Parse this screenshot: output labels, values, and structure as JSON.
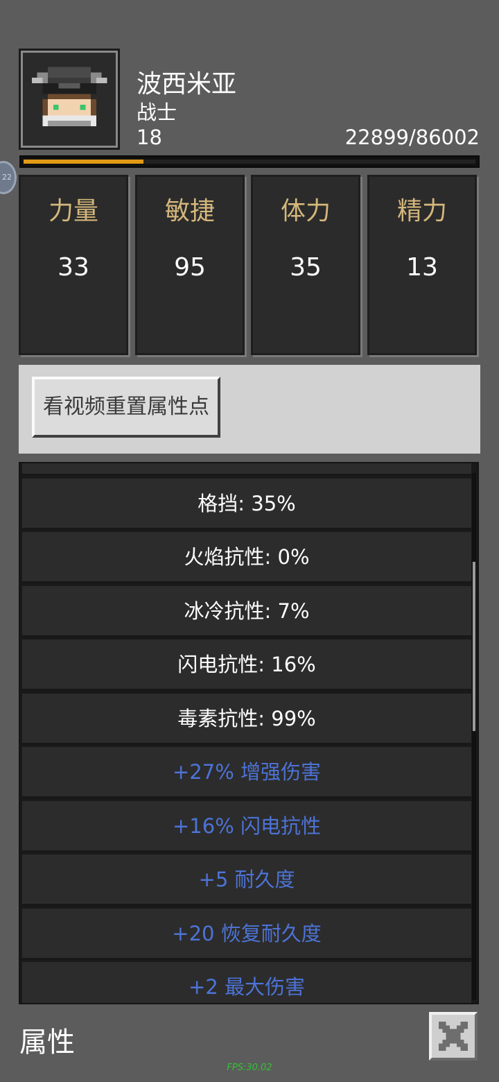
{
  "character": {
    "name": "波西米亚",
    "class": "战士",
    "level": "18",
    "exp_text": "22899/86002",
    "exp_progress": 0.266,
    "portrait_icon": "helmeted-warrior-avatar"
  },
  "side_badge": {
    "text": "22"
  },
  "stats": [
    {
      "label": "力量",
      "value": "33"
    },
    {
      "label": "敏捷",
      "value": "95"
    },
    {
      "label": "体力",
      "value": "35"
    },
    {
      "label": "精力",
      "value": "13"
    }
  ],
  "reset_button_label": "看视频重置属性点",
  "attributes": [
    {
      "text": "格挡: 35%",
      "type": "stat"
    },
    {
      "text": "火焰抗性: 0%",
      "type": "stat"
    },
    {
      "text": "冰冷抗性: 7%",
      "type": "stat"
    },
    {
      "text": "闪电抗性: 16%",
      "type": "stat"
    },
    {
      "text": "毒素抗性: 99%",
      "type": "stat"
    },
    {
      "text": "+27% 增强伤害",
      "type": "bonus"
    },
    {
      "text": "+16% 闪电抗性",
      "type": "bonus"
    },
    {
      "text": "+5 耐久度",
      "type": "bonus"
    },
    {
      "text": "+20 恢复耐久度",
      "type": "bonus"
    },
    {
      "text": "+2 最大伤害",
      "type": "bonus"
    }
  ],
  "footer": {
    "title": "属性",
    "close_icon": "close-icon",
    "fps": "FPS:30.02"
  },
  "colors": {
    "background": "#5c5c5c",
    "stat_label": "#d4b77c",
    "bonus_text": "#4d73d6",
    "exp_fill": "#e29a16",
    "fps": "#35c235"
  }
}
